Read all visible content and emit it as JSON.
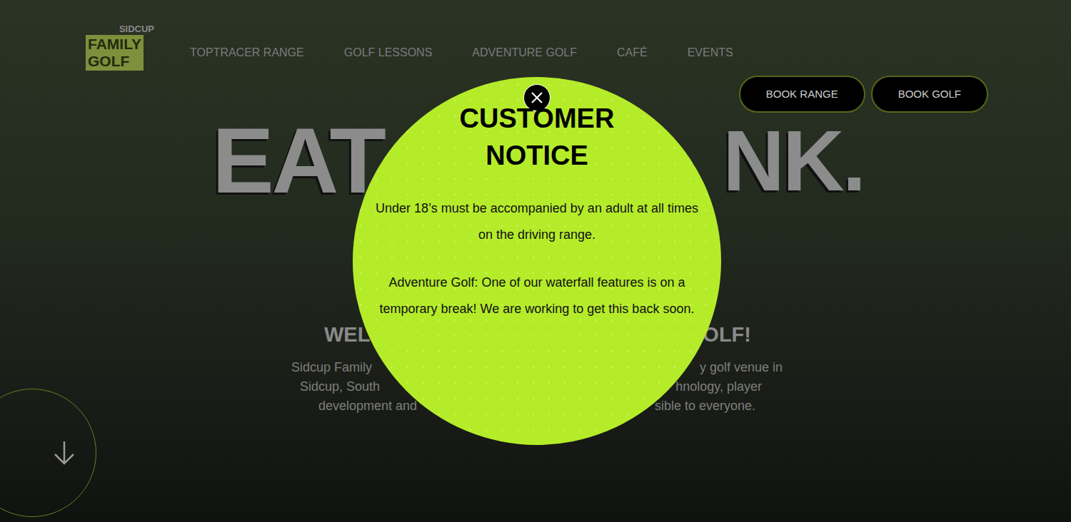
{
  "logo": {
    "top": "SIDCUP",
    "lines": [
      "FAMILY",
      "GOLF"
    ]
  },
  "nav": {
    "items": [
      "TOPTRACER RANGE",
      "GOLF LESSONS",
      "ADVENTURE GOLF",
      "CAFÉ",
      "EVENTS"
    ]
  },
  "buttons": [
    "BOOK RANGE",
    "BOOK GOLF"
  ],
  "hero": {
    "headline_left": "EAT",
    "headline_right": "NK.",
    "welcome_left": "WEL",
    "welcome_right": "OLF!",
    "text_left": [
      "Sidcup Family",
      "Sidcup, South",
      "development and"
    ],
    "text_right": [
      "y golf venue in",
      "hnology, player",
      "sible to everyone."
    ]
  },
  "modal": {
    "title_lines": [
      "CUSTOMER",
      "NOTICE"
    ],
    "paragraphs": [
      "Under 18’s must be accompanied by an adult at all times on the driving range.",
      "Adventure Golf: One of our waterfall features is on a temporary break! We are working to get this back soon."
    ]
  }
}
